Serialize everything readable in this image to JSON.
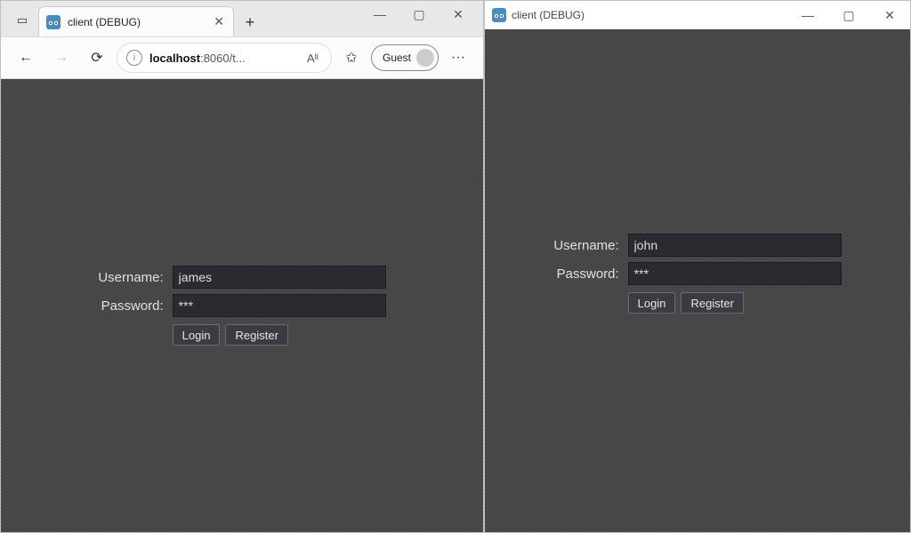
{
  "left": {
    "tab_title": "client (DEBUG)",
    "address_host": "localhost",
    "address_rest": ":8060/t...",
    "guest_label": "Guest",
    "win": {
      "min": "—",
      "max": "▢",
      "close": "✕"
    },
    "nav": {
      "back": "←",
      "fwd": "→",
      "reload": "⟳",
      "read": "Aᴵᴵ",
      "fav": "✩",
      "more": "···",
      "plus": "+",
      "tabclose": "✕",
      "tabpanel": "▭"
    },
    "form": {
      "username_label": "Username:",
      "password_label": "Password:",
      "username_value": "james",
      "password_value": "***",
      "login_label": "Login",
      "register_label": "Register"
    }
  },
  "right": {
    "window_title": "client (DEBUG)",
    "win": {
      "min": "—",
      "max": "▢",
      "close": "✕"
    },
    "form": {
      "username_label": "Username:",
      "password_label": "Password:",
      "username_value": "john",
      "password_value": "***",
      "login_label": "Login",
      "register_label": "Register"
    }
  }
}
